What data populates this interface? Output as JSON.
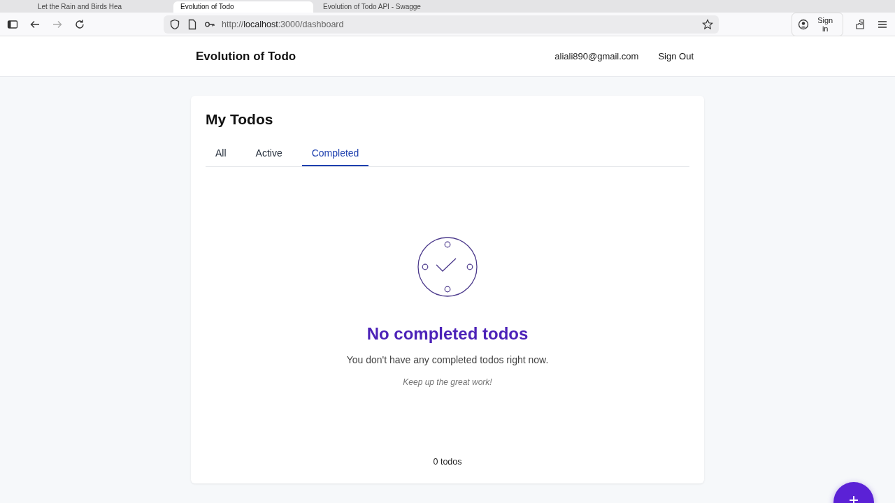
{
  "browser": {
    "tabs": [
      {
        "title": "Let the Rain and Birds Hea",
        "selected": false
      },
      {
        "title": "Evolution of Todo",
        "selected": true
      },
      {
        "title": "Evolution of Todo API - Swagge",
        "selected": false
      }
    ],
    "url_prefix": "http://",
    "url_host": "localhost",
    "url_rest": ":3000/dashboard",
    "sign_in": "Sign in"
  },
  "header": {
    "app_title": "Evolution of Todo",
    "email": "aliali890@gmail.com",
    "sign_out": "Sign Out"
  },
  "card": {
    "title": "My Todos",
    "tabs": [
      {
        "label": "All",
        "selected": false
      },
      {
        "label": "Active",
        "selected": false
      },
      {
        "label": "Completed",
        "selected": true
      }
    ],
    "empty_title": "No completed todos",
    "empty_text": "You don't have any completed todos right now.",
    "empty_note": "Keep up the great work!",
    "count": "0 todos"
  }
}
